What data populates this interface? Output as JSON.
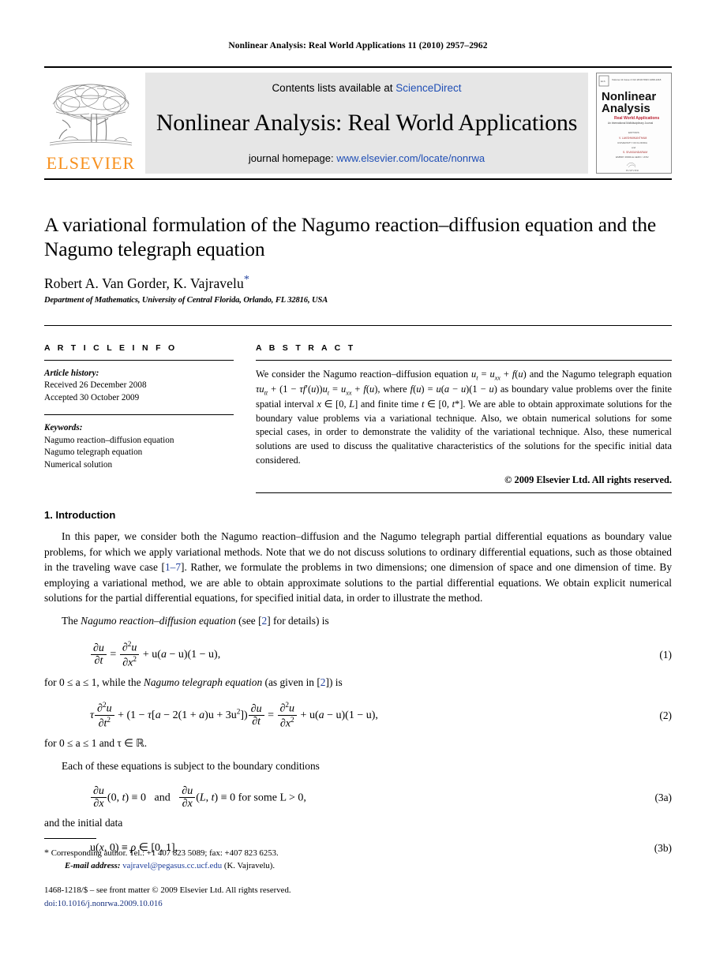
{
  "running_head": "Nonlinear Analysis: Real World Applications 11 (2010) 2957–2962",
  "masthead": {
    "publisher_name": "ELSEVIER",
    "contents_prefix": "Contents lists available at ",
    "contents_link": "ScienceDirect",
    "journal_name": "Nonlinear Analysis: Real World Applications",
    "homepage_prefix": "journal homepage: ",
    "homepage_link": "www.elsevier.com/locate/nonrwa",
    "cover": {
      "line1": "Nonlinear",
      "line2": "Analysis",
      "subtitle": "Real World Applications",
      "subtitle2": "An International Multidisciplinary Journal",
      "editors_label": "EDITORS",
      "editor1": "V. LAKSHMIKANTHAM",
      "editor2": "UNIVERSITY OF FLORIDA",
      "and": "and",
      "editor3": "S. SIVASUNDARAM",
      "editor4": "EMBRY-RIDDLE AERO. UNIV.",
      "footer": "ELSEVIER",
      "top_meta": "Volume 11   Issue 4   October 2010   ISSN 1468-1218"
    }
  },
  "title": "A variational formulation of the Nagumo reaction–diffusion equation and the Nagumo telegraph equation",
  "authors": "Robert A. Van Gorder, K. Vajravelu",
  "corresponding_marker": "*",
  "affiliation": "Department of Mathematics, University of Central Florida, Orlando, FL 32816, USA",
  "article_info": {
    "label": "A R T I C L E    I N F O",
    "history_label": "Article history:",
    "history": [
      "Received 26 December 2008",
      "Accepted 30 October 2009"
    ],
    "keywords_label": "Keywords:",
    "keywords": [
      "Nagumo reaction–diffusion equation",
      "Nagumo telegraph equation",
      "Numerical solution"
    ]
  },
  "abstract": {
    "label": "A B S T R A C T",
    "text": "We consider the Nagumo reaction–diffusion equation u_t = u_xx + f(u) and the Nagumo telegraph equation τu_tt + (1 − τf′(u))u_t = u_xx + f(u), where f(u) = u(a − u)(1 − u) as boundary value problems over the finite spatial interval x ∈ [0, L] and finite time t ∈ [0, t*]. We are able to obtain approximate solutions for the boundary value problems via a variational technique. Also, we obtain numerical solutions for some special cases, in order to demonstrate the validity of the variational technique. Also, these numerical solutions are used to discuss the qualitative characteristics of the solutions for the specific initial data considered.",
    "copyright": "© 2009 Elsevier Ltd. All rights reserved."
  },
  "section": {
    "number_title": "1. Introduction",
    "paragraph1_a": "In this paper, we consider both the Nagumo reaction–diffusion and the Nagumo telegraph partial differential equations as boundary value problems, for which we apply variational methods. Note that we do not discuss solutions to ordinary differential equations, such as those obtained in the traveling wave case [",
    "paragraph1_ref": "1–7",
    "paragraph1_b": "]. Rather, we formulate the problems in two dimensions; one dimension of space and one dimension of time. By employing a variational method, we are able to obtain approximate solutions to the partial differential equations. We obtain explicit numerical solutions for the partial differential equations, for specified initial data, in order to illustrate the method.",
    "lead_eq1_a": "The ",
    "lead_eq1_ital": "Nagumo reaction–diffusion equation",
    "lead_eq1_b": " (see [",
    "lead_eq1_ref": "2",
    "lead_eq1_c": "] for details) is",
    "after_eq1_a": "for 0 ≤ a ≤ 1, while the ",
    "after_eq1_ital": "Nagumo telegraph equation",
    "after_eq1_b": " (as given in [",
    "after_eq1_ref": "2",
    "after_eq1_c": "]) is",
    "after_eq2": "for 0 ≤ a ≤ 1 and τ ∈ ℝ.",
    "lead_eq3a": "Each of these equations is subject to the boundary conditions",
    "after_eq3a": "and the initial data"
  },
  "equations": {
    "eq1_number": "(1)",
    "eq2_number": "(2)",
    "eq3a_number": "(3a)",
    "eq3b_number": "(3b)",
    "eq1_text": "∂u/∂t = ∂²u/∂x² + u(a − u)(1 − u),",
    "eq2_text": "τ ∂²u/∂t² + (1 − τ[a − 2(1 + a)u + 3u²])∂u/∂t = ∂²u/∂x² + u(a − u)(1 − u),",
    "eq3a_text": "∂u/∂x(0, t) ≡ 0  and  ∂u/∂x(L, t) ≡ 0 for some L > 0,",
    "eq3b_text": "u(x, 0) ≡ ρ ∈ [0, 1],",
    "eq3a_and": "and",
    "eq3a_tail": "for some L > 0,"
  },
  "footnotes": {
    "star": "*",
    "corresponding": "Corresponding author. Tel.: +1 407 823 5089; fax: +407 823 6253.",
    "email_label": "E-mail address:",
    "email": "vajravel@pegasus.cc.ucf.edu",
    "email_owner": "(K. Vajravelu).",
    "imprint": "1468-1218/$ – see front matter © 2009 Elsevier Ltd. All rights reserved.",
    "doi": "doi:10.1016/j.nonrwa.2009.10.016"
  },
  "colors": {
    "link": "#1f4eb5",
    "reference": "#1f3f9c",
    "elsevier_orange": "#F7901E",
    "masthead_bg": "#e6e6e6"
  }
}
